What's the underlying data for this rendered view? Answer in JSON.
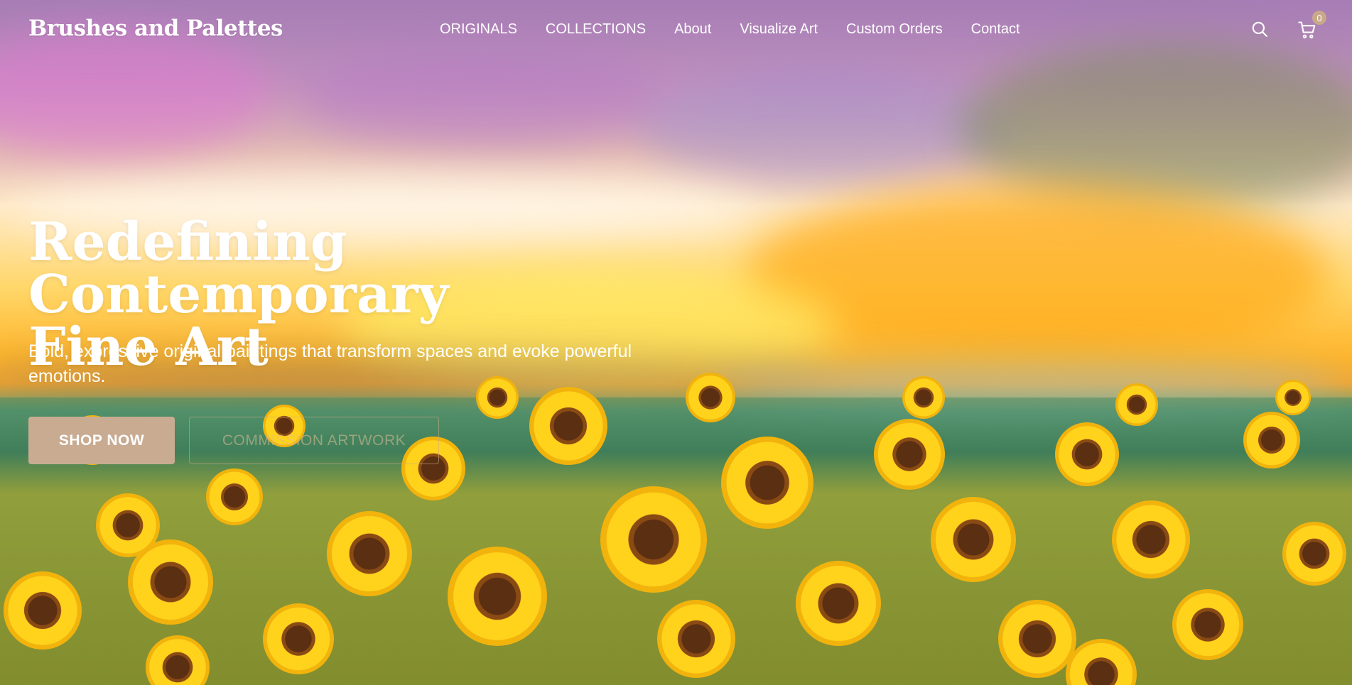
{
  "brand": {
    "name": "Brushes and Palettes"
  },
  "nav": {
    "items": [
      {
        "label": "ORIGINALS"
      },
      {
        "label": "COLLECTIONS"
      },
      {
        "label": "About"
      },
      {
        "label": "Visualize Art"
      },
      {
        "label": "Custom Orders"
      },
      {
        "label": "Contact"
      }
    ]
  },
  "header_icons": {
    "search": "search-icon",
    "cart": "cart-icon",
    "cart_count": "0"
  },
  "hero": {
    "title_line1": "Redefining Contemporary",
    "title_line2": "Fine Art",
    "subtitle": "Bold, expressive original paintings that transform spaces and evoke powerful emotions.",
    "primary_button": "SHOP NOW",
    "secondary_button": "COMMISSION ARTWORK",
    "background": "sunflower field painting"
  },
  "colors": {
    "accent": "#c9ab91",
    "text_on_image": "#ffffff",
    "badge": "#c9a989"
  }
}
